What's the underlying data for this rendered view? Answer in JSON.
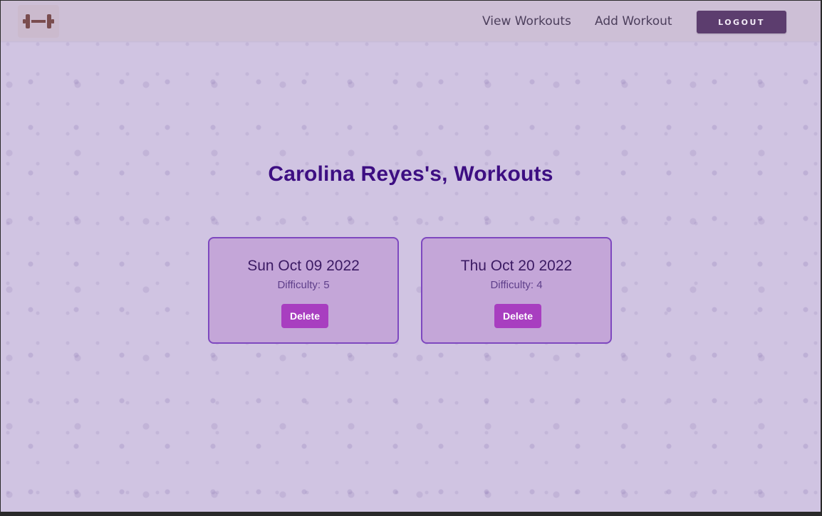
{
  "navbar": {
    "logo_icon": "dumbbell-icon",
    "links": [
      {
        "label": "View Workouts"
      },
      {
        "label": "Add Workout"
      }
    ],
    "logout_label": "LOGOUT"
  },
  "main": {
    "title": "Carolina Reyes's, Workouts",
    "workouts": [
      {
        "date": "Sun Oct 09 2022",
        "difficulty": "Difficulty: 5",
        "delete_label": "Delete"
      },
      {
        "date": "Thu Oct 20 2022",
        "difficulty": "Difficulty: 4",
        "delete_label": "Delete"
      }
    ]
  },
  "colors": {
    "background": "#d0c4e2",
    "navbar": "#cdbfd6",
    "logo": "#7a4d4f",
    "logout_button": "#5c3d6e",
    "title": "#3d0e82",
    "card_background": "#c4a6d8",
    "card_border": "#7e48bf",
    "delete_button": "#a83ec0"
  }
}
